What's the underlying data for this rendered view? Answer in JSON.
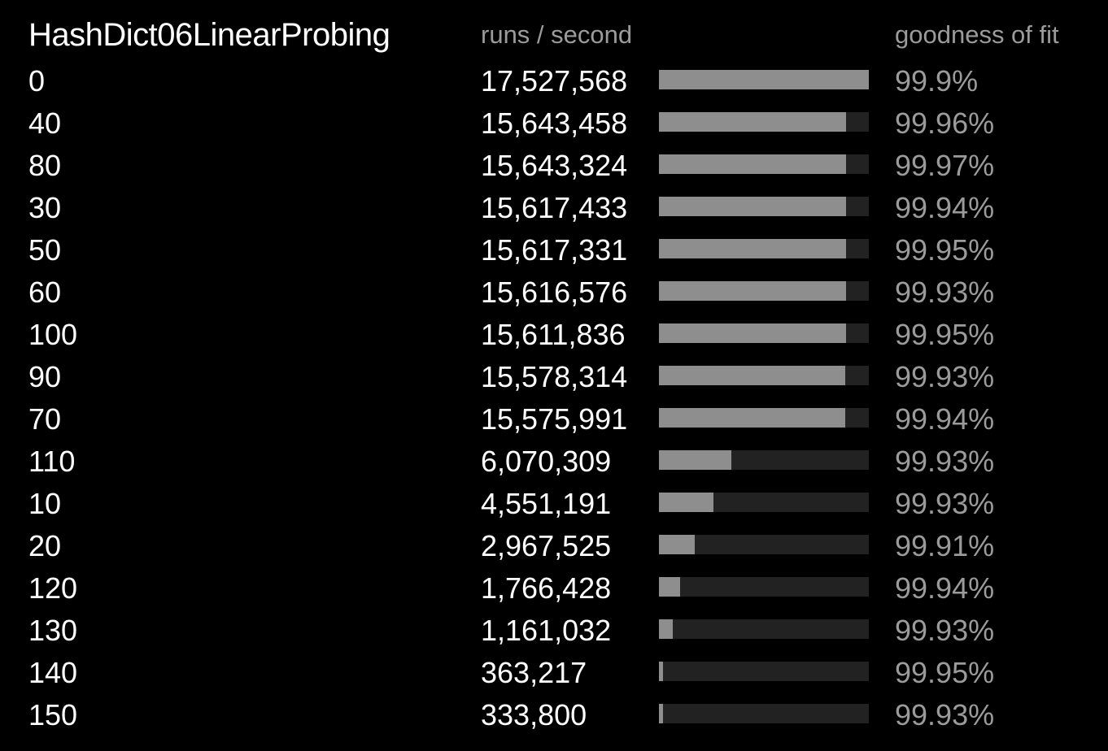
{
  "chart_data": {
    "type": "bar",
    "title": "HashDict06LinearProbing",
    "value_header": "runs / second",
    "fit_header": "goodness of fit",
    "categories": [
      "0",
      "40",
      "80",
      "30",
      "50",
      "60",
      "100",
      "90",
      "70",
      "110",
      "10",
      "20",
      "120",
      "130",
      "140",
      "150"
    ],
    "values": [
      17527568,
      15643458,
      15643324,
      15617433,
      15617331,
      15616576,
      15611836,
      15578314,
      15575991,
      6070309,
      4551191,
      2967525,
      1766428,
      1161032,
      363217,
      333800
    ],
    "value_labels": [
      "17,527,568",
      "15,643,458",
      "15,643,324",
      "15,617,433",
      "15,617,331",
      "15,616,576",
      "15,611,836",
      "15,578,314",
      "15,575,991",
      "6,070,309",
      "4,551,191",
      "2,967,525",
      "1,766,428",
      "1,161,032",
      "363,217",
      "333,800"
    ],
    "goodness_of_fit": [
      "99.9%",
      "99.96%",
      "99.97%",
      "99.94%",
      "99.95%",
      "99.93%",
      "99.95%",
      "99.93%",
      "99.94%",
      "99.93%",
      "99.93%",
      "99.91%",
      "99.94%",
      "99.93%",
      "99.95%",
      "99.93%"
    ],
    "xlim": [
      0,
      17527568
    ],
    "grid": false,
    "legend": "none",
    "colors": {
      "background": "#000000",
      "bar_fill": "#8e8e8e",
      "bar_track": "#222222",
      "primary_text": "#ffffff",
      "secondary_text": "#9b9b9b"
    }
  }
}
